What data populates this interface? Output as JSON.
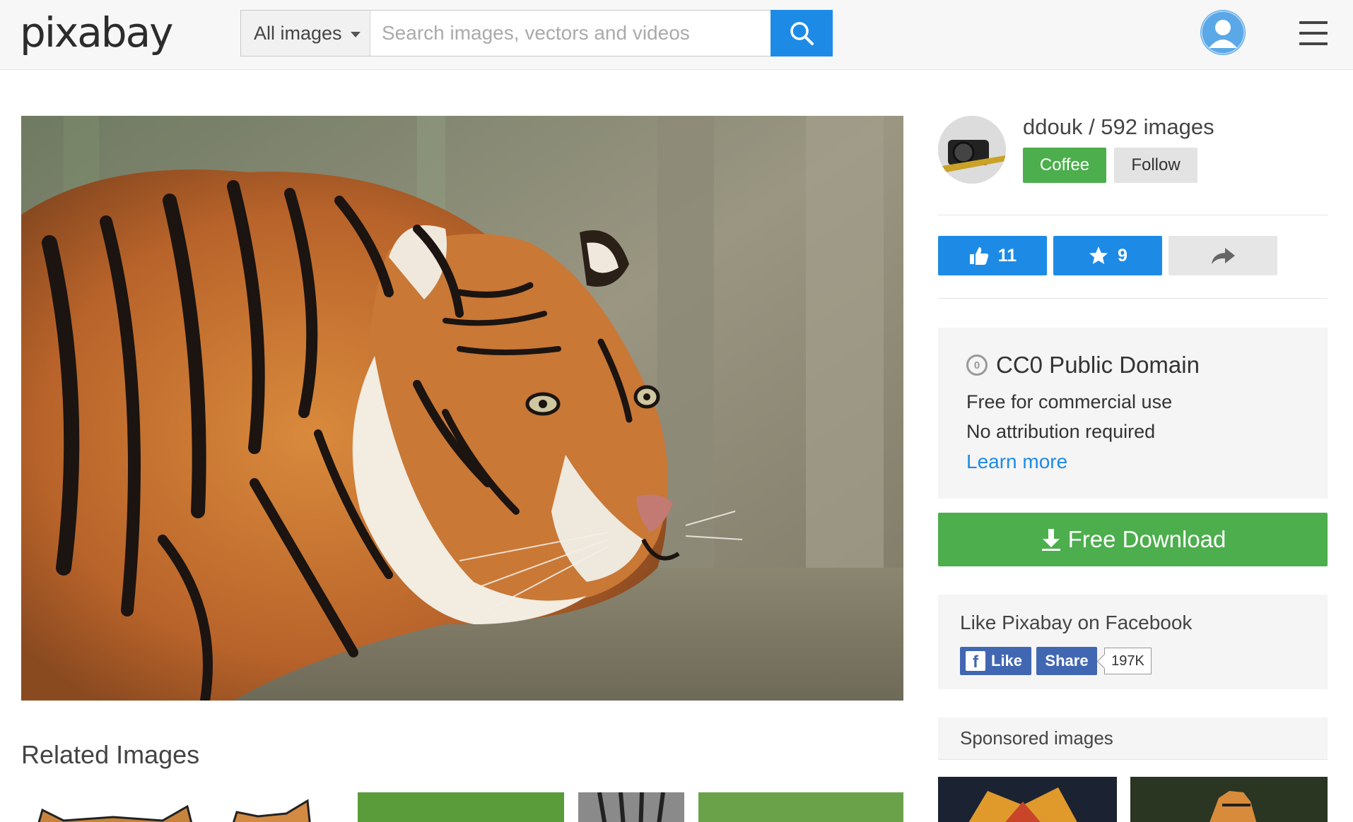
{
  "header": {
    "logo": "pixabay",
    "category_label": "All images",
    "search_placeholder": "Search images, vectors and videos"
  },
  "photo": {
    "subject": "tiger",
    "colors": {
      "fur": "#c8742e",
      "stripe": "#1a1410",
      "background": "#8b8a70"
    }
  },
  "related": {
    "title": "Related Images"
  },
  "user": {
    "name_line": "ddouk / 592 images",
    "coffee_label": "Coffee",
    "follow_label": "Follow"
  },
  "actions": {
    "likes": "11",
    "favorites": "9"
  },
  "license": {
    "icon_text": "0",
    "title": "CC0 Public Domain",
    "line1": "Free for commercial use",
    "line2": "No attribution required",
    "link": "Learn more"
  },
  "download": {
    "label": "Free Download"
  },
  "facebook": {
    "title": "Like Pixabay on Facebook",
    "like_label": "Like",
    "f_glyph": "f",
    "share_label": "Share",
    "count": "197K"
  },
  "sponsored": {
    "title": "Sponsored images"
  },
  "colors": {
    "accent_blue": "#1d8be6",
    "accent_green": "#4cae4c",
    "facebook_blue": "#4267b2"
  }
}
